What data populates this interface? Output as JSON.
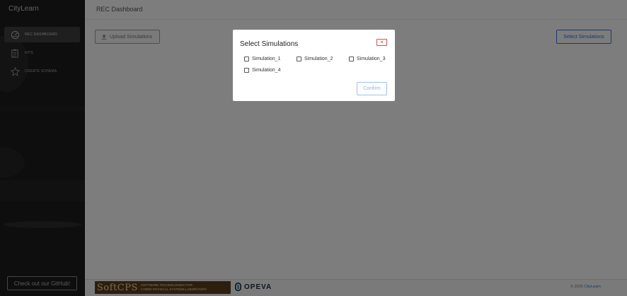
{
  "sidebar": {
    "brand": "CityLearn",
    "items": [
      {
        "label": "REC DASHBOARD",
        "icon": "dashboard-gauge-icon",
        "active": true
      },
      {
        "label": "KPIS",
        "icon": "clipboard-icon",
        "active": false
      },
      {
        "label": "CREATE SCHEMA",
        "icon": "schema-star-icon",
        "active": false
      }
    ],
    "github_label": "Check out our GitHub!"
  },
  "header": {
    "title": "REC Dashboard"
  },
  "toolbar": {
    "upload_label": "Upload Simulations",
    "upload_icon": "upload-icon",
    "select_label": "Select Simulations"
  },
  "modal": {
    "title": "Select Simulations",
    "close_icon": "close-icon",
    "options": [
      {
        "label": "Simulation_1",
        "checked": false
      },
      {
        "label": "Simulation_2",
        "checked": false
      },
      {
        "label": "Simulation_3",
        "checked": false
      },
      {
        "label": "Simulation_4",
        "checked": false
      }
    ],
    "confirm_label": "Confirm"
  },
  "footer": {
    "softcps_big": "SoftCPS",
    "softcps_line1": "SOFTWARE TECHNOLOGIES FOR",
    "softcps_line2": "CYBER-PHYSICAL SYSTEMS LABORATORY",
    "opeva": "OPEVA",
    "copyright_prefix": "© 2025",
    "copyright_link": "CityLearn"
  },
  "colors": {
    "accent": "#3a6fd8",
    "close_red": "#e04b4b",
    "sidebar_bg": "#1c1c1c"
  }
}
